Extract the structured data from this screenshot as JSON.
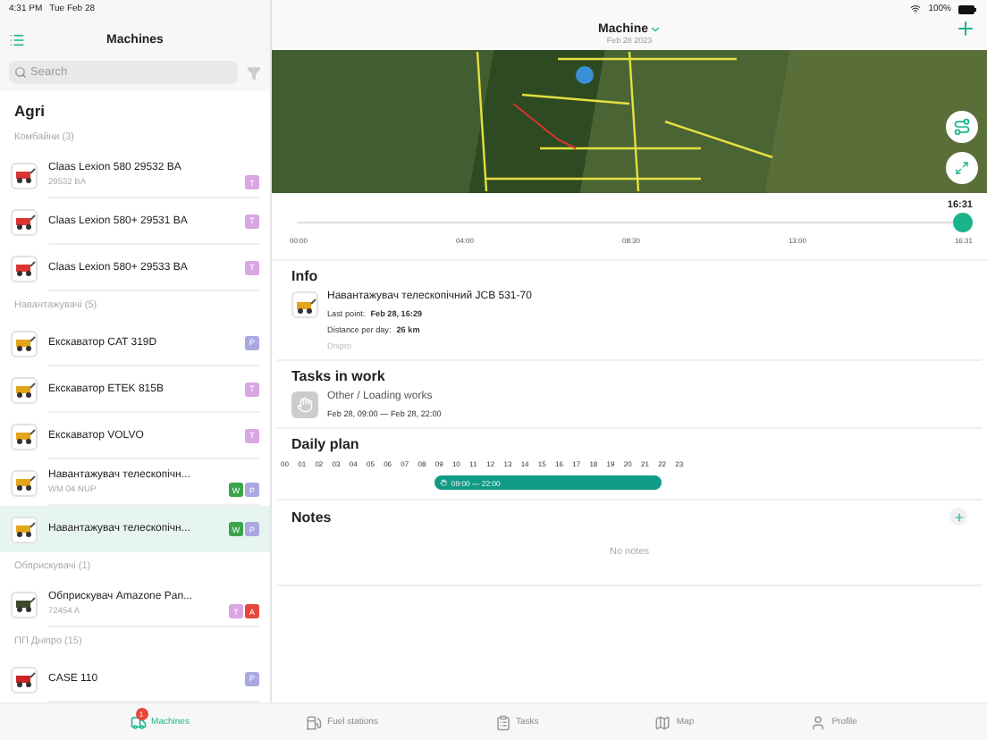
{
  "status_bar": {
    "time": "4:31 PM",
    "date": "Tue Feb 28",
    "battery": "100%"
  },
  "sidebar": {
    "title": "Machines",
    "search": {
      "placeholder": "Search"
    },
    "group": "Agri",
    "categories": [
      {
        "name": "Комбайни (3)",
        "machines": [
          {
            "name": "Claas Lexion 580  29532 BA",
            "plate": "29532 BA",
            "kind": "combine",
            "selected": false,
            "badges": [
              {
                "letter": "T",
                "color": "#d9a6e2"
              }
            ]
          },
          {
            "name": "Claas Lexion 580+ 29531 BA",
            "kind": "combine",
            "selected": false,
            "badges": [
              {
                "letter": "T",
                "color": "#d9a6e2"
              }
            ]
          },
          {
            "name": "Claas Lexion 580+ 29533 BA",
            "kind": "combine",
            "selected": false,
            "badges": [
              {
                "letter": "T",
                "color": "#d9a6e2"
              }
            ]
          }
        ]
      },
      {
        "name": "Навантажувачі (5)",
        "machines": [
          {
            "name": "Екскаватор CAT 319D",
            "kind": "excavator",
            "selected": false,
            "badges": [
              {
                "letter": "P",
                "color": "#a9a8e3"
              }
            ]
          },
          {
            "name": "Екскаватор ETEK 815B",
            "kind": "excavator",
            "selected": false,
            "badges": [
              {
                "letter": "T",
                "color": "#d9a6e2"
              }
            ]
          },
          {
            "name": "Екскаватор VOLVO",
            "kind": "excavator",
            "selected": false,
            "badges": [
              {
                "letter": "T",
                "color": "#d9a6e2"
              }
            ]
          },
          {
            "name": "Навантажувач телескопічн...",
            "plate": "WM 04 NUP",
            "kind": "loader",
            "selected": false,
            "badges": [
              {
                "letter": "W",
                "color": "#3ba44b"
              },
              {
                "letter": "P",
                "color": "#a9a8e3"
              }
            ]
          },
          {
            "name": "Навантажувач телескопічн...",
            "kind": "loader",
            "selected": true,
            "badges": [
              {
                "letter": "W",
                "color": "#3ba44b"
              },
              {
                "letter": "P",
                "color": "#a9a8e3"
              }
            ]
          }
        ]
      },
      {
        "name": "Обприскувачі (1)",
        "machines": [
          {
            "name": "Обприскувач Amazone Pan...",
            "plate": "72454 A",
            "kind": "sprayer",
            "selected": false,
            "badges": [
              {
                "letter": "T",
                "color": "#d9a6e2"
              },
              {
                "letter": "A",
                "color": "#e8473d"
              }
            ]
          }
        ]
      },
      {
        "name": "ПП Дніпро (15)",
        "machines": [
          {
            "name": "CASE 110",
            "kind": "tractor",
            "selected": false,
            "badges": [
              {
                "letter": "P",
                "color": "#a9a8e3"
              }
            ]
          }
        ]
      }
    ]
  },
  "detail": {
    "title": "Machine",
    "subtitle": "Feb 28 2023",
    "timeline": {
      "reading": "16:31",
      "level": 1,
      "ticks": [
        "00:00",
        "04:00",
        "08:30",
        "13:00",
        "16:31"
      ]
    },
    "info": {
      "heading": "Info",
      "name": "Навантажувач телескопічний JCB 531-70",
      "last_point_label": "Last point:",
      "last_point": "Feb 28, 16:29",
      "distance_label": "Distance per day:",
      "distance": "26 km",
      "region": "Dnipro"
    },
    "tasks": {
      "heading": "Tasks in work",
      "items": [
        {
          "title": "Other / Loading works",
          "period": "Feb 28, 09:00 — Feb 28, 22:00"
        }
      ]
    },
    "daily_plan": {
      "heading": "Daily plan",
      "bar": {
        "label": "09:00 — 22:00"
      },
      "hours": [
        "00",
        "01",
        "02",
        "03",
        "04",
        "05",
        "06",
        "07",
        "08",
        "09",
        "10",
        "11",
        "12",
        "13",
        "14",
        "15",
        "16",
        "17",
        "18",
        "19",
        "20",
        "21",
        "22",
        "23"
      ]
    },
    "notes": {
      "heading": "Notes",
      "empty": "No notes"
    }
  },
  "tab_bar": [
    {
      "label": "Machines",
      "selected": true,
      "badge": "1"
    },
    {
      "label": "Fuel stations",
      "selected": false
    },
    {
      "label": "Tasks",
      "selected": false
    },
    {
      "label": "Map",
      "selected": false
    },
    {
      "label": "Profile",
      "selected": false
    }
  ]
}
